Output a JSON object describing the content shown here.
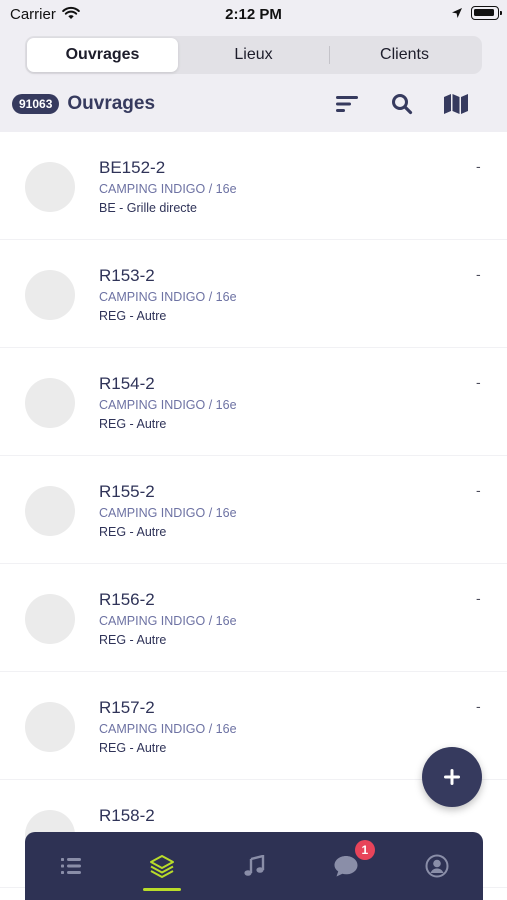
{
  "status_bar": {
    "carrier": "Carrier",
    "time": "2:12 PM"
  },
  "segmented_control": {
    "tabs": [
      {
        "label": "Ouvrages",
        "selected": true
      },
      {
        "label": "Lieux",
        "selected": false
      },
      {
        "label": "Clients",
        "selected": false
      }
    ]
  },
  "header": {
    "count": "91063",
    "title": "Ouvrages"
  },
  "icons": {
    "sort": "sort-icon",
    "search": "search-icon",
    "map": "map-icon",
    "add": "plus-icon"
  },
  "items": [
    {
      "title": "BE152-2",
      "location": "CAMPING INDIGO / 16e",
      "type": "BE - Grille directe",
      "value": "-"
    },
    {
      "title": "R153-2",
      "location": "CAMPING INDIGO / 16e",
      "type": "REG - Autre",
      "value": "-"
    },
    {
      "title": "R154-2",
      "location": "CAMPING INDIGO / 16e",
      "type": "REG - Autre",
      "value": "-"
    },
    {
      "title": "R155-2",
      "location": "CAMPING INDIGO / 16e",
      "type": "REG - Autre",
      "value": "-"
    },
    {
      "title": "R156-2",
      "location": "CAMPING INDIGO / 16e",
      "type": "REG - Autre",
      "value": "-"
    },
    {
      "title": "R157-2",
      "location": "CAMPING INDIGO / 16e",
      "type": "REG - Autre",
      "value": "-"
    },
    {
      "title": "R158-2",
      "location": "",
      "type": "",
      "value": ""
    }
  ],
  "tab_bar": {
    "tabs": [
      {
        "icon": "list-icon",
        "active": false
      },
      {
        "icon": "layers-icon",
        "active": true
      },
      {
        "icon": "music-note-icon",
        "active": false
      },
      {
        "icon": "chat-bubble-icon",
        "active": false,
        "badge": "1"
      },
      {
        "icon": "user-circle-icon",
        "active": false
      }
    ]
  },
  "colors": {
    "navy": "#363a5e",
    "tab_bar_bg": "#2e3254",
    "active_accent": "#b9dc2a",
    "badge_red": "#e8445a",
    "subtitle": "#6d72a3",
    "header_bg": "#efeef3"
  }
}
